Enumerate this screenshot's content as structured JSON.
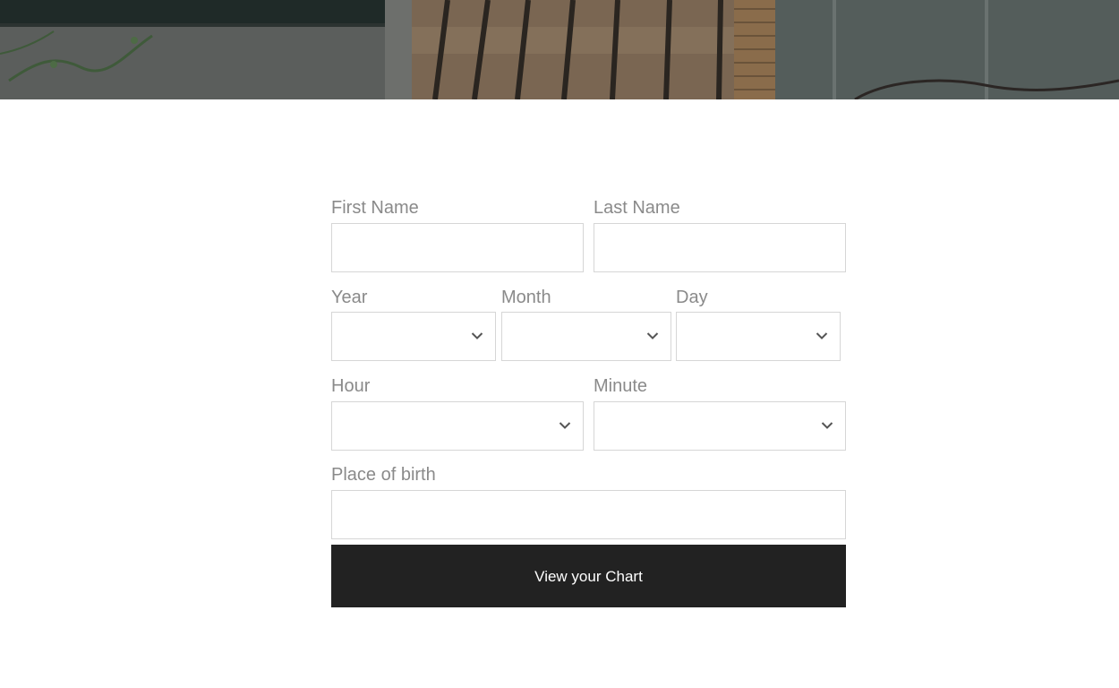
{
  "form": {
    "first_name": {
      "label": "First Name",
      "value": ""
    },
    "last_name": {
      "label": "Last Name",
      "value": ""
    },
    "year": {
      "label": "Year",
      "selected": ""
    },
    "month": {
      "label": "Month",
      "selected": ""
    },
    "day": {
      "label": "Day",
      "selected": ""
    },
    "hour": {
      "label": "Hour",
      "selected": ""
    },
    "minute": {
      "label": "Minute",
      "selected": ""
    },
    "place_of_birth": {
      "label": "Place of birth",
      "value": ""
    },
    "submit_label": "View your Chart"
  },
  "icons": {
    "select_indicator": "chevron-down-icon"
  },
  "colors": {
    "label": "#8a8a8a",
    "border": "#d6d6d6",
    "button_bg": "#222222",
    "button_text": "#ffffff"
  }
}
